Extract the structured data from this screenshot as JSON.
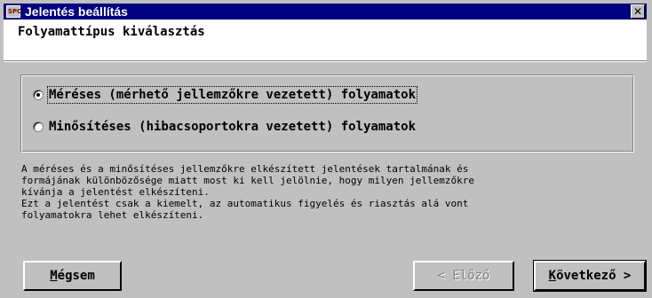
{
  "window": {
    "title": "Jelentés beállítás",
    "app_icon_text": "SPC",
    "close_glyph": "✕",
    "title_bar_color": "#000080"
  },
  "header": {
    "title": "Folyamattípus kiválasztás"
  },
  "options": [
    {
      "label": "Méréses (mérhető jellemzőkre vezetett) folyamatok",
      "checked": true,
      "focused": true
    },
    {
      "label": "Minősítéses (hibacsoportokra vezetett) folyamatok",
      "checked": false,
      "focused": false
    }
  ],
  "description": "A méréses és a minősítéses jellemzőkre elkészített jelentések tartalmának és\nformájának különbözősége miatt most ki kell jelölnie, hogy milyen jellemzőkre\nkívánja a jelentést elkészíteni.\nEzt a jelentést csak a kiemelt, az automatikus figyelés és riasztás alá vont\nfolyamatokra lehet elkészíteni.",
  "buttons": {
    "cancel": "Mégsem",
    "back": "< Előző",
    "next": "Következő >"
  }
}
